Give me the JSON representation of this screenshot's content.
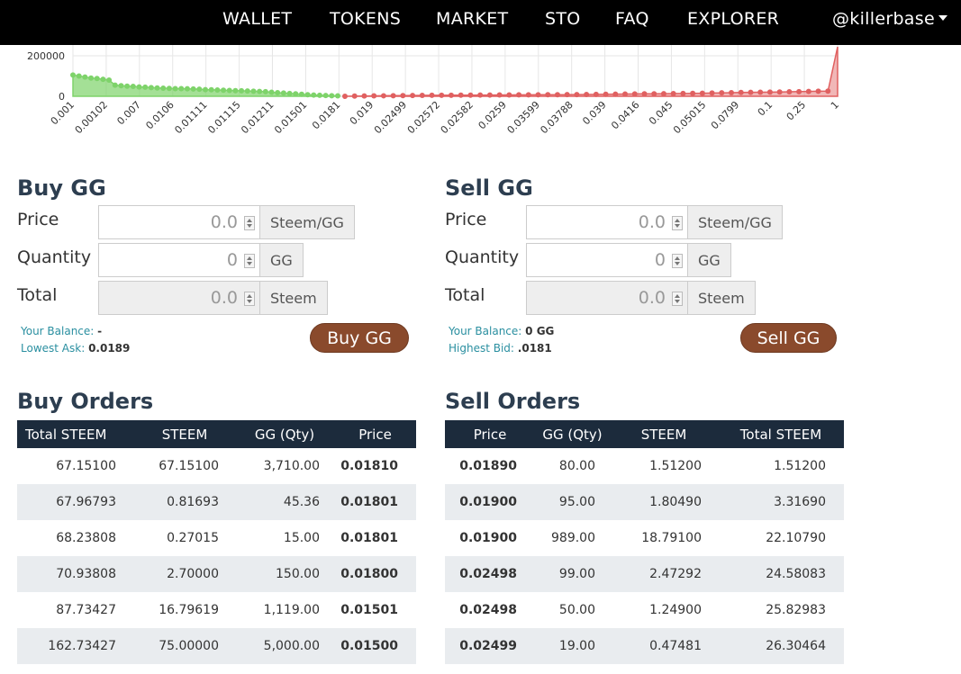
{
  "nav": {
    "items": [
      "WALLET",
      "TOKENS",
      "MARKET",
      "STO",
      "FAQ",
      "EXPLORER"
    ],
    "user": "@killerbase"
  },
  "chart_data": {
    "type": "area",
    "y_ticks": [
      "200000",
      "0"
    ],
    "ylim": [
      0,
      260000
    ],
    "x_labels": [
      "0.001",
      "0.00102",
      "0.007",
      "0.0106",
      "0.01111",
      "0.01115",
      "0.01211",
      "0.01501",
      "0.0181",
      "0.019",
      "0.02499",
      "0.02572",
      "0.02582",
      "0.0259",
      "0.03599",
      "0.03788",
      "0.039",
      "0.0416",
      "0.045",
      "0.05015",
      "0.0799",
      "0.1",
      "0.25",
      "1"
    ],
    "series": [
      {
        "side": "bids",
        "color": "#7ed36a",
        "values": [
          105000,
          100000,
          95000,
          90000,
          88000,
          84000,
          80000,
          55000,
          52000,
          50000,
          49000,
          46000,
          45000,
          43000,
          41000,
          40000,
          39000,
          38000,
          38000,
          37000,
          36000,
          35000,
          33000,
          32000,
          31000,
          30000,
          29000,
          28000,
          27000,
          26000,
          25000,
          24000,
          23000,
          20000,
          18000,
          16000,
          14000,
          12000,
          10000,
          8000,
          6000,
          5000,
          4000,
          3000,
          2000
        ]
      },
      {
        "side": "asks",
        "color": "#e06060",
        "values": [
          0,
          1000,
          1500,
          2000,
          2500,
          3000,
          3500,
          4000,
          4500,
          5000,
          5000,
          5200,
          5500,
          5800,
          6000,
          6200,
          6500,
          6800,
          7000,
          7200,
          7500,
          7800,
          8000,
          8200,
          8500,
          9000,
          9500,
          10000,
          10500,
          11000,
          11500,
          12000,
          12500,
          13000,
          13500,
          14000,
          14500,
          15000,
          16000,
          17000,
          18000,
          19000,
          19500,
          20000,
          20500,
          21000,
          22000,
          23000,
          24000,
          25000,
          25500,
          260000
        ]
      }
    ]
  },
  "buy": {
    "title": "Buy GG",
    "price_label": "Price",
    "price_value": "0.0",
    "price_unit": "Steem/GG",
    "qty_label": "Quantity",
    "qty_value": "0",
    "qty_unit": "GG",
    "total_label": "Total",
    "total_value": "0.0",
    "total_unit": "Steem",
    "balance_label": "Your Balance:",
    "balance_value": "-",
    "ask_label": "Lowest Ask:",
    "ask_value": "0.0189",
    "button": "Buy GG"
  },
  "sell": {
    "title": "Sell GG",
    "price_label": "Price",
    "price_value": "0.0",
    "price_unit": "Steem/GG",
    "qty_label": "Quantity",
    "qty_value": "0",
    "qty_unit": "GG",
    "total_label": "Total",
    "total_value": "0.0",
    "total_unit": "Steem",
    "balance_label": "Your Balance:",
    "balance_value": "0 GG",
    "bid_label": "Highest Bid:",
    "bid_value": ".0181",
    "button": "Sell GG"
  },
  "buy_orders": {
    "title": "Buy Orders",
    "headers": [
      "Total STEEM",
      "STEEM",
      "GG (Qty)",
      "Price"
    ],
    "rows": [
      [
        "67.15100",
        "67.15100",
        "3,710.00",
        "0.01810"
      ],
      [
        "67.96793",
        "0.81693",
        "45.36",
        "0.01801"
      ],
      [
        "68.23808",
        "0.27015",
        "15.00",
        "0.01801"
      ],
      [
        "70.93808",
        "2.70000",
        "150.00",
        "0.01800"
      ],
      [
        "87.73427",
        "16.79619",
        "1,119.00",
        "0.01501"
      ],
      [
        "162.73427",
        "75.00000",
        "5,000.00",
        "0.01500"
      ]
    ]
  },
  "sell_orders": {
    "title": "Sell Orders",
    "headers": [
      "Price",
      "GG (Qty)",
      "STEEM",
      "Total STEEM"
    ],
    "rows": [
      [
        "0.01890",
        "80.00",
        "1.51200",
        "1.51200"
      ],
      [
        "0.01900",
        "95.00",
        "1.80490",
        "3.31690"
      ],
      [
        "0.01900",
        "989.00",
        "18.79100",
        "22.10790"
      ],
      [
        "0.02498",
        "99.00",
        "2.47292",
        "24.58083"
      ],
      [
        "0.02498",
        "50.00",
        "1.24900",
        "25.82983"
      ],
      [
        "0.02499",
        "19.00",
        "0.47481",
        "26.30464"
      ]
    ]
  }
}
